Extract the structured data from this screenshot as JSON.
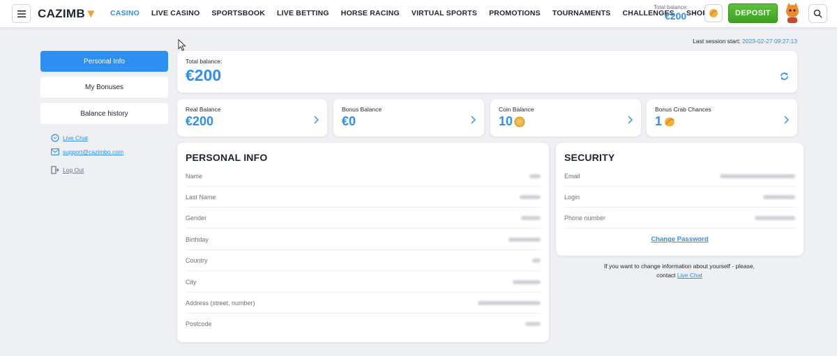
{
  "brand": {
    "logo_text": "CAZIMB",
    "logo_suffix": "🐱"
  },
  "nav": {
    "items": [
      {
        "label": "CASINO",
        "active": true
      },
      {
        "label": "LIVE CASINO"
      },
      {
        "label": "SPORTSBOOK"
      },
      {
        "label": "LIVE BETTING"
      },
      {
        "label": "HORSE RACING"
      },
      {
        "label": "VIRTUAL SPORTS"
      },
      {
        "label": "PROMOTIONS"
      },
      {
        "label": "TOURNAMENTS"
      },
      {
        "label": "CHALLENGES"
      },
      {
        "label": "SHOP"
      }
    ]
  },
  "header": {
    "balance_label": "Total balance:",
    "balance_value": "€200",
    "deposit_label": "DEPOSIT"
  },
  "session": {
    "label": "Last session start:",
    "timestamp": "2023-02-27 09:27:13"
  },
  "sidebar": {
    "items": [
      {
        "label": "Personal Info",
        "active": true
      },
      {
        "label": "My Bonuses"
      },
      {
        "label": "Balance history"
      }
    ],
    "links": {
      "live_chat": "Live Chat",
      "email": "support@cazimbo.com",
      "logout": "Log Out"
    }
  },
  "total_balance": {
    "label": "Total balance:",
    "value": "€200"
  },
  "balances": [
    {
      "label": "Real Balance",
      "value": "€200"
    },
    {
      "label": "Bonus Balance",
      "value": "€0"
    },
    {
      "label": "Coin Balance",
      "value": "10"
    },
    {
      "label": "Bonus Crab Chances",
      "value": "1"
    }
  ],
  "personal_info": {
    "title": "PERSONAL INFO",
    "fields": [
      "Name",
      "Last Name",
      "Gender",
      "Birthday",
      "Country",
      "City",
      "Address (street, number)",
      "Postcode"
    ]
  },
  "security": {
    "title": "SECURITY",
    "fields": [
      "Email",
      "Login",
      "Phone number"
    ],
    "change_password": "Change Password"
  },
  "info_note": {
    "line1": "If you want to change information about yourself - please,",
    "line2_prefix": "contact",
    "link": "Live Chat"
  },
  "colors": {
    "accent": "#2f8ef2",
    "deposit": "#4cb22c",
    "background": "#eef0f3"
  },
  "icons": [
    "menu-icon",
    "coin-icon",
    "avatar-icon",
    "search-icon",
    "refresh-icon",
    "chevron-right-icon",
    "chat-icon",
    "mail-icon",
    "logout-icon"
  ]
}
